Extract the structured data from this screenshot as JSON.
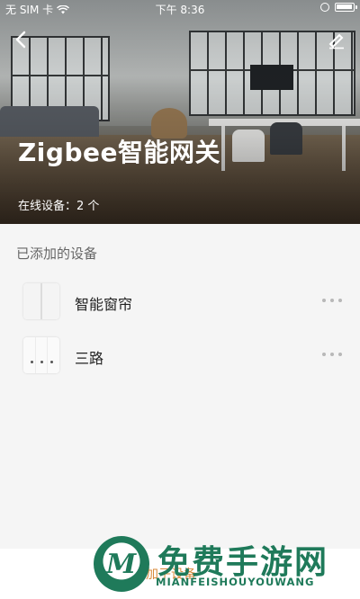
{
  "status_bar": {
    "carrier": "无 SIM 卡",
    "time": "下午 8:36"
  },
  "header": {
    "title": "Zigbee智能网关",
    "online_devices": "在线设备：2 个"
  },
  "section": {
    "title": "已添加的设备"
  },
  "devices": [
    {
      "name": "智能窗帘",
      "icon": "curtain-icon"
    },
    {
      "name": "三路",
      "icon": "switch-icon"
    }
  ],
  "bottom": {
    "add_device_label": "添加子设备"
  },
  "watermark": {
    "title": "免费手游网",
    "subtitle": "MIANFEISHOUYOUWANG"
  },
  "colors": {
    "accent": "#d98a3a",
    "watermark": "#1f7a5a",
    "background": "#f5f5f5"
  }
}
